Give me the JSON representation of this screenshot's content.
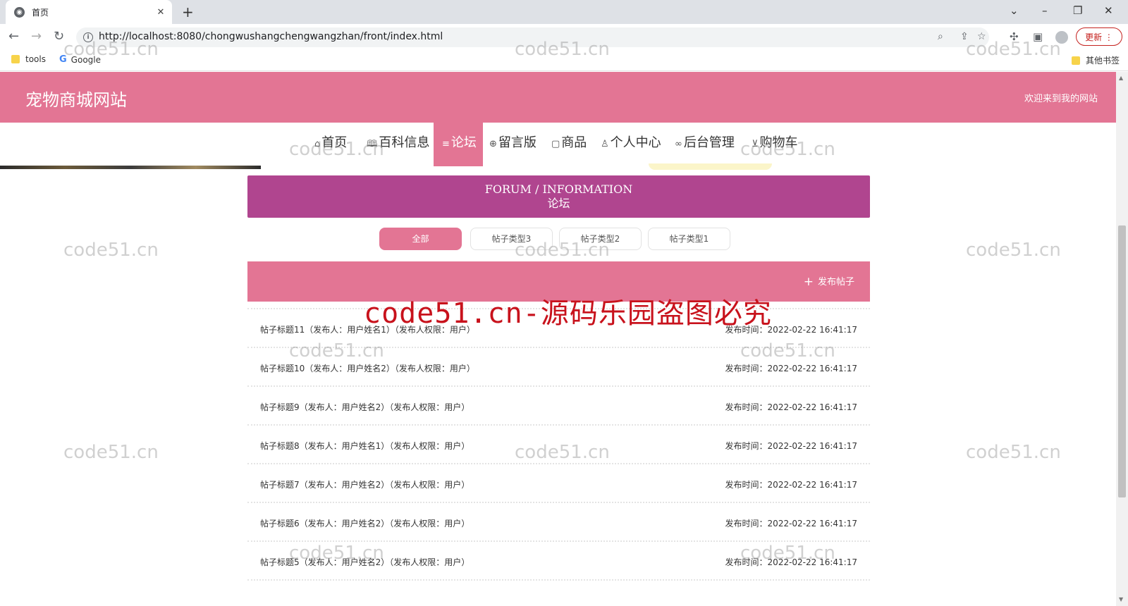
{
  "browser": {
    "tab_title": "首页",
    "url": "http://localhost:8080/chongwushangchengwangzhan/front/index.html",
    "update_label": "更新",
    "bookmarks": [
      {
        "label": "tools",
        "icon": "folder-icon"
      },
      {
        "label": "Google",
        "icon": "google-icon"
      }
    ],
    "other_bookmarks": "其他书签"
  },
  "site": {
    "title": "宠物商城网站",
    "welcome": "欢迎来到我的网站"
  },
  "nav": {
    "items": [
      {
        "label": "首页",
        "icon": "home-icon",
        "glyph": "⌂"
      },
      {
        "label": "百科信息",
        "icon": "book-icon",
        "glyph": "🕮"
      },
      {
        "label": "论坛",
        "icon": "list-icon",
        "glyph": "≡",
        "active": true
      },
      {
        "label": "留言版",
        "icon": "globe-icon",
        "glyph": "⊕"
      },
      {
        "label": "商品",
        "icon": "tag-icon",
        "glyph": "▢"
      },
      {
        "label": "个人中心",
        "icon": "user-icon",
        "glyph": "♙"
      },
      {
        "label": "后台管理",
        "icon": "link-icon",
        "glyph": "∞"
      },
      {
        "label": "购物车",
        "icon": "cart-icon",
        "glyph": "⊻"
      }
    ]
  },
  "forum": {
    "title_en": "FORUM / INFORMATION",
    "title_cn": "论坛",
    "filters": [
      "全部",
      "帖子类型3",
      "帖子类型2",
      "帖子类型1"
    ],
    "active_filter": "全部",
    "post_button": "发布帖子",
    "posts": [
      {
        "title": "帖子标题11（发布人：用户姓名1）（发布人权限：用户）",
        "time": "发布时间：2022-02-22 16:41:17"
      },
      {
        "title": "帖子标题10（发布人：用户姓名2）（发布人权限：用户）",
        "time": "发布时间：2022-02-22 16:41:17"
      },
      {
        "title": "帖子标题9（发布人：用户姓名2）（发布人权限：用户）",
        "time": "发布时间：2022-02-22 16:41:17"
      },
      {
        "title": "帖子标题8（发布人：用户姓名1）（发布人权限：用户）",
        "time": "发布时间：2022-02-22 16:41:17"
      },
      {
        "title": "帖子标题7（发布人：用户姓名2）（发布人权限：用户）",
        "time": "发布时间：2022-02-22 16:41:17"
      },
      {
        "title": "帖子标题6（发布人：用户姓名2）（发布人权限：用户）",
        "time": "发布时间：2022-02-22 16:41:17"
      },
      {
        "title": "帖子标题5（发布人：用户姓名2）（发布人权限：用户）",
        "time": "发布时间：2022-02-22 16:41:17"
      }
    ]
  },
  "watermarks": {
    "small": "code51.cn",
    "large": "code51.cn-源码乐园盗图必究"
  },
  "colors": {
    "header_pink": "#e37594",
    "banner_purple": "#b0458f",
    "watermark_red": "#c8121c"
  }
}
